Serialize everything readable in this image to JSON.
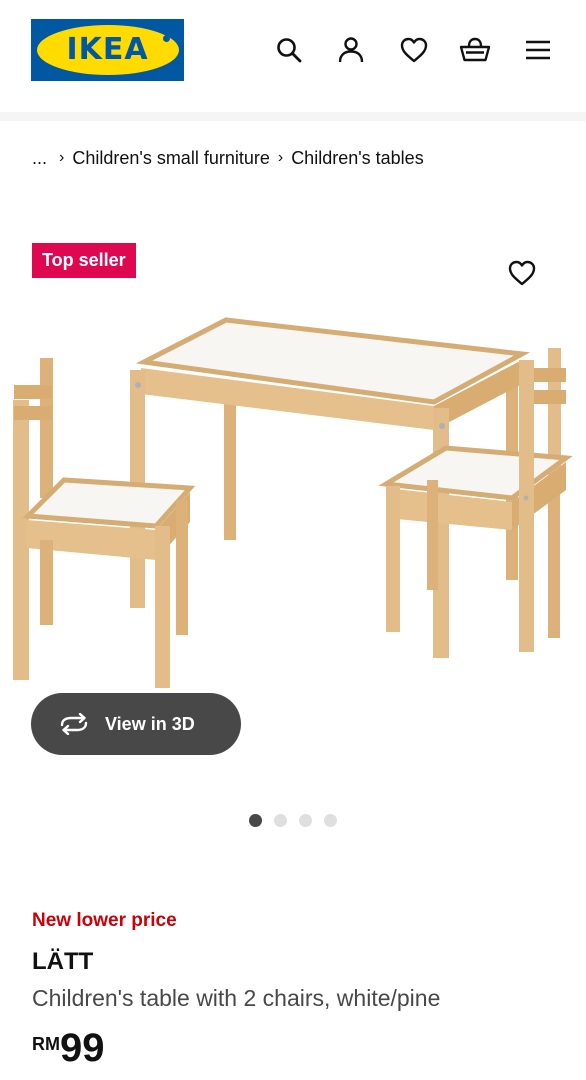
{
  "header": {
    "logo_text": "IKEA",
    "icons": [
      "search-icon",
      "account-icon",
      "heart-icon",
      "basket-icon",
      "menu-icon"
    ],
    "brand_blue": "#0058a3",
    "brand_yellow": "#ffdb00"
  },
  "breadcrumb": {
    "ellipsis": "...",
    "separator": "›",
    "items": [
      "Children's small furniture",
      "Children's tables"
    ]
  },
  "product": {
    "badge": "Top seller",
    "badge_color": "#e00751",
    "image_icon": "favourite-heart-icon",
    "view3d_label": "View in 3D",
    "carousel_pages": 4,
    "carousel_active": 1,
    "price_note": "New lower price",
    "price_note_color": "#cc0008",
    "name": "LÄTT",
    "description": "Children's table with 2 chairs, white/pine",
    "currency": "RM",
    "price": "99"
  }
}
